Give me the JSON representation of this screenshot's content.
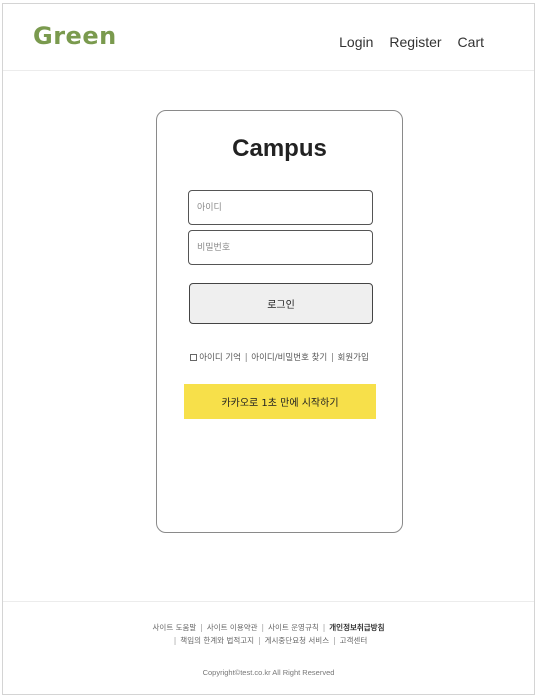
{
  "header": {
    "logo": "Green",
    "nav": {
      "login": "Login",
      "register": "Register",
      "cart": "Cart"
    }
  },
  "card": {
    "title": "Campus",
    "id_placeholder": "아이디",
    "pw_placeholder": "비밀번호",
    "login_button": "로그인",
    "remember_label": "아이디 기억",
    "find_link": "아이디/비밀번호 찾기",
    "join_link": "회원가입",
    "separator": "|",
    "kakao_button": "카카오로 1초 만에 시작하기"
  },
  "footer": {
    "row1": [
      {
        "label": "사이트 도움말",
        "bold": false
      },
      {
        "label": "사이트 이용약관",
        "bold": false
      },
      {
        "label": "사이트 운영규칙",
        "bold": false
      },
      {
        "label": "개인정보취급방침",
        "bold": true
      }
    ],
    "row2": [
      {
        "label": "책임의 한계와 법적고지",
        "bold": false
      },
      {
        "label": "게시중단요청 서비스",
        "bold": false
      },
      {
        "label": "고객센터",
        "bold": false
      }
    ],
    "copyright": "Copyright©test.co.kr All Right Reserved"
  },
  "colors": {
    "logo": "#7a9a4e",
    "kakao": "#f7e04a",
    "login_button_bg": "#efefef"
  }
}
